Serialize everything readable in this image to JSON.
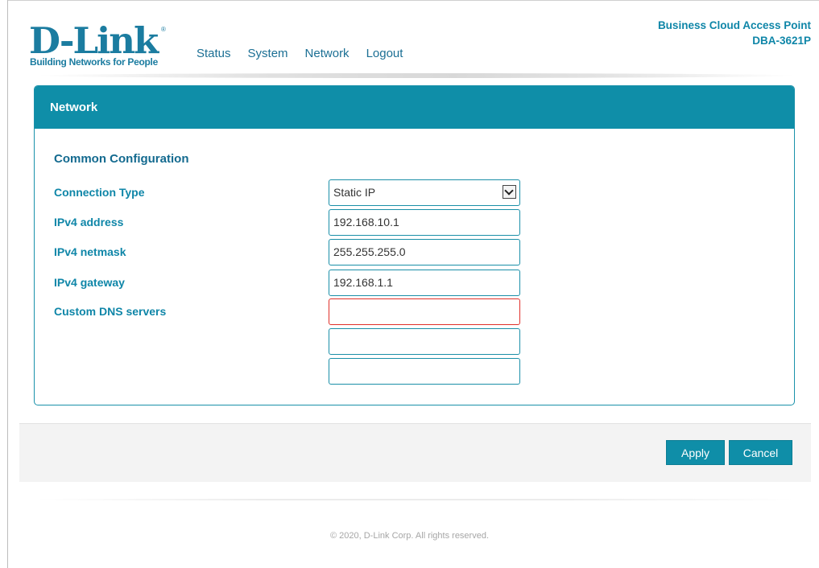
{
  "brand": {
    "name": "D-Link",
    "registered": "®",
    "tagline": "Building Networks for People"
  },
  "nav": {
    "items": [
      {
        "label": "Status"
      },
      {
        "label": "System"
      },
      {
        "label": "Network"
      },
      {
        "label": "Logout"
      }
    ]
  },
  "product": {
    "line1": "Business Cloud Access Point",
    "line2": "DBA-3621P"
  },
  "panel": {
    "title": "Network",
    "section_title": "Common Configuration",
    "connection_type": {
      "label": "Connection Type",
      "value": "Static IP"
    },
    "ipv4_address": {
      "label": "IPv4 address",
      "value": "192.168.10.1"
    },
    "ipv4_netmask": {
      "label": "IPv4 netmask",
      "value": "255.255.255.0"
    },
    "ipv4_gateway": {
      "label": "IPv4 gateway",
      "value": "192.168.1.1"
    },
    "dns": {
      "label": "Custom DNS servers",
      "values": [
        "",
        "",
        ""
      ]
    }
  },
  "actions": {
    "apply": "Apply",
    "cancel": "Cancel"
  },
  "footer": {
    "copyright": "© 2020, D-Link Corp. All rights reserved."
  },
  "colors": {
    "accent": "#0f8ea8",
    "error": "#e0302a"
  }
}
